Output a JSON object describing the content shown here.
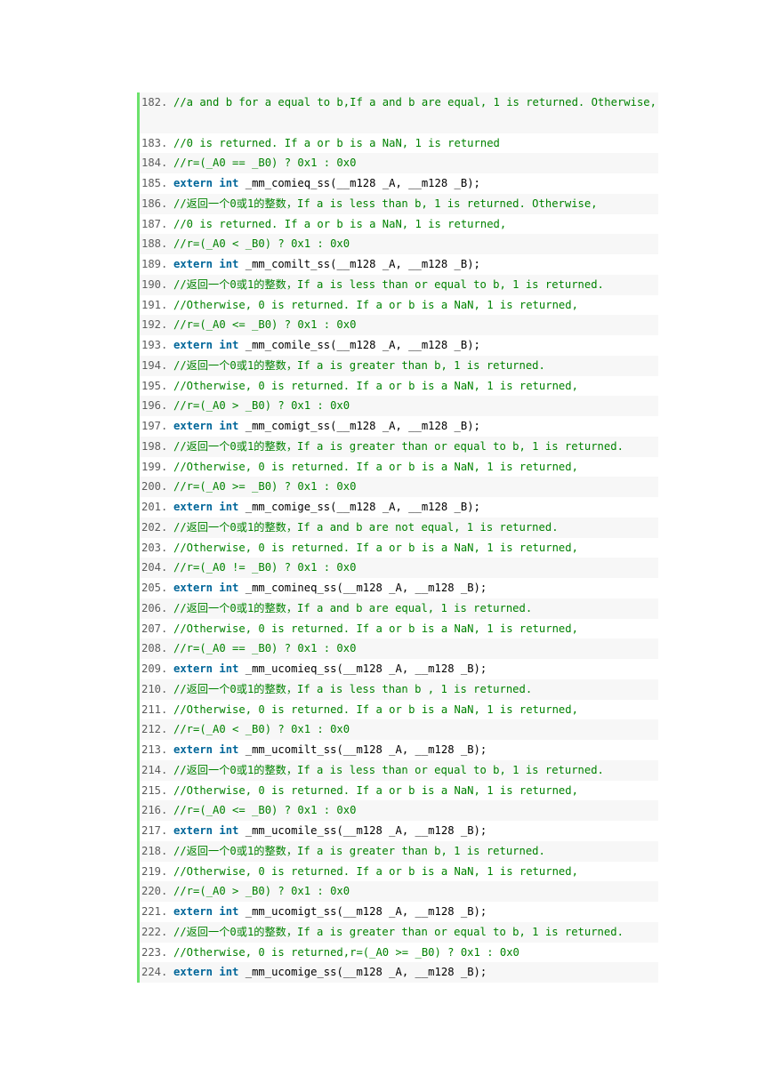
{
  "lines": [
    {
      "n": "182.",
      "parts": [
        [
          "c",
          "//a and b for a equal to b,If a and b are equal, 1 is returned. Otherwise,"
        ]
      ],
      "tall": true
    },
    {
      "n": "183.",
      "parts": [
        [
          "c",
          "//0 is returned. If a or b is a NaN, 1 is returned"
        ]
      ]
    },
    {
      "n": "184.",
      "parts": [
        [
          "c",
          "//r=(_A0 == _B0) ? 0x1 : 0x0"
        ]
      ]
    },
    {
      "n": "185.",
      "parts": [
        [
          "k",
          "extern"
        ],
        [
          "p",
          " "
        ],
        [
          "k",
          "int"
        ],
        [
          "p",
          " _mm_comieq_ss(__m128 _A, __m128 _B);"
        ]
      ]
    },
    {
      "n": "186.",
      "parts": [
        [
          "c",
          "//返回一个0或1的整数，If a is less than b, 1 is returned. Otherwise,"
        ]
      ]
    },
    {
      "n": "187.",
      "parts": [
        [
          "c",
          "//0 is returned. If a or b is a NaN, 1 is returned,"
        ]
      ]
    },
    {
      "n": "188.",
      "parts": [
        [
          "c",
          "//r=(_A0 < _B0) ? 0x1 : 0x0"
        ]
      ]
    },
    {
      "n": "189.",
      "parts": [
        [
          "k",
          "extern"
        ],
        [
          "p",
          " "
        ],
        [
          "k",
          "int"
        ],
        [
          "p",
          " _mm_comilt_ss(__m128 _A, __m128 _B);"
        ]
      ]
    },
    {
      "n": "190.",
      "parts": [
        [
          "c",
          "//返回一个0或1的整数，If a is less than or equal to b, 1 is returned."
        ]
      ]
    },
    {
      "n": "191.",
      "parts": [
        [
          "c",
          "//Otherwise, 0 is returned. If a or b is a NaN, 1 is returned,"
        ]
      ]
    },
    {
      "n": "192.",
      "parts": [
        [
          "c",
          "//r=(_A0 <= _B0) ? 0x1 : 0x0"
        ]
      ]
    },
    {
      "n": "193.",
      "parts": [
        [
          "k",
          "extern"
        ],
        [
          "p",
          " "
        ],
        [
          "k",
          "int"
        ],
        [
          "p",
          " _mm_comile_ss(__m128 _A, __m128 _B);"
        ]
      ]
    },
    {
      "n": "194.",
      "parts": [
        [
          "c",
          "//返回一个0或1的整数，If a is greater than b, 1 is returned."
        ]
      ]
    },
    {
      "n": "195.",
      "parts": [
        [
          "c",
          "//Otherwise, 0 is returned. If a or b is a NaN, 1 is returned,"
        ]
      ]
    },
    {
      "n": "196.",
      "parts": [
        [
          "c",
          "//r=(_A0 > _B0) ? 0x1 : 0x0"
        ]
      ]
    },
    {
      "n": "197.",
      "parts": [
        [
          "k",
          "extern"
        ],
        [
          "p",
          " "
        ],
        [
          "k",
          "int"
        ],
        [
          "p",
          " _mm_comigt_ss(__m128 _A, __m128 _B);"
        ]
      ]
    },
    {
      "n": "198.",
      "parts": [
        [
          "c",
          "//返回一个0或1的整数，If a is greater than or equal to b, 1 is returned."
        ]
      ]
    },
    {
      "n": "199.",
      "parts": [
        [
          "c",
          "//Otherwise, 0 is returned. If a or b is a NaN, 1 is returned,"
        ]
      ]
    },
    {
      "n": "200.",
      "parts": [
        [
          "c",
          "//r=(_A0 >= _B0) ? 0x1 : 0x0"
        ]
      ]
    },
    {
      "n": "201.",
      "parts": [
        [
          "k",
          "extern"
        ],
        [
          "p",
          " "
        ],
        [
          "k",
          "int"
        ],
        [
          "p",
          " _mm_comige_ss(__m128 _A, __m128 _B);"
        ]
      ]
    },
    {
      "n": "202.",
      "parts": [
        [
          "c",
          "//返回一个0或1的整数，If a and b are not equal, 1 is returned."
        ]
      ]
    },
    {
      "n": "203.",
      "parts": [
        [
          "c",
          "//Otherwise, 0 is returned. If a or b is a NaN, 1 is returned,"
        ]
      ]
    },
    {
      "n": "204.",
      "parts": [
        [
          "c",
          "//r=(_A0 != _B0) ? 0x1 : 0x0"
        ]
      ]
    },
    {
      "n": "205.",
      "parts": [
        [
          "k",
          "extern"
        ],
        [
          "p",
          " "
        ],
        [
          "k",
          "int"
        ],
        [
          "p",
          " _mm_comineq_ss(__m128 _A, __m128 _B);"
        ]
      ]
    },
    {
      "n": "206.",
      "parts": [
        [
          "c",
          "//返回一个0或1的整数，If a and b are equal, 1 is returned."
        ]
      ]
    },
    {
      "n": "207.",
      "parts": [
        [
          "c",
          "//Otherwise, 0 is returned. If a or b is a NaN, 1 is returned,"
        ]
      ]
    },
    {
      "n": "208.",
      "parts": [
        [
          "c",
          "//r=(_A0 == _B0) ? 0x1 : 0x0"
        ]
      ]
    },
    {
      "n": "209.",
      "parts": [
        [
          "k",
          "extern"
        ],
        [
          "p",
          " "
        ],
        [
          "k",
          "int"
        ],
        [
          "p",
          " _mm_ucomieq_ss(__m128 _A, __m128 _B);"
        ]
      ]
    },
    {
      "n": "210.",
      "parts": [
        [
          "c",
          "//返回一个0或1的整数，If a is less than b , 1 is returned."
        ]
      ]
    },
    {
      "n": "211.",
      "parts": [
        [
          "c",
          "//Otherwise, 0 is returned. If a or b is a NaN, 1 is returned,"
        ]
      ]
    },
    {
      "n": "212.",
      "parts": [
        [
          "c",
          "//r=(_A0 < _B0) ? 0x1 : 0x0"
        ]
      ]
    },
    {
      "n": "213.",
      "parts": [
        [
          "k",
          "extern"
        ],
        [
          "p",
          " "
        ],
        [
          "k",
          "int"
        ],
        [
          "p",
          " _mm_ucomilt_ss(__m128 _A, __m128 _B);"
        ]
      ]
    },
    {
      "n": "214.",
      "parts": [
        [
          "c",
          "//返回一个0或1的整数，If a is less than or equal to b, 1 is returned."
        ]
      ]
    },
    {
      "n": "215.",
      "parts": [
        [
          "c",
          "//Otherwise, 0 is returned. If a or b is a NaN, 1 is returned,"
        ]
      ]
    },
    {
      "n": "216.",
      "parts": [
        [
          "c",
          "//r=(_A0 <= _B0) ? 0x1 : 0x0"
        ]
      ]
    },
    {
      "n": "217.",
      "parts": [
        [
          "k",
          "extern"
        ],
        [
          "p",
          " "
        ],
        [
          "k",
          "int"
        ],
        [
          "p",
          " _mm_ucomile_ss(__m128 _A, __m128 _B);"
        ]
      ]
    },
    {
      "n": "218.",
      "parts": [
        [
          "c",
          "//返回一个0或1的整数，If a is greater than b, 1 is returned."
        ]
      ]
    },
    {
      "n": "219.",
      "parts": [
        [
          "c",
          "//Otherwise, 0 is returned. If a or b is a NaN, 1 is returned,"
        ]
      ]
    },
    {
      "n": "220.",
      "parts": [
        [
          "c",
          "//r=(_A0 > _B0) ? 0x1 : 0x0"
        ]
      ]
    },
    {
      "n": "221.",
      "parts": [
        [
          "k",
          "extern"
        ],
        [
          "p",
          " "
        ],
        [
          "k",
          "int"
        ],
        [
          "p",
          " _mm_ucomigt_ss(__m128 _A, __m128 _B);"
        ]
      ]
    },
    {
      "n": "222.",
      "parts": [
        [
          "c",
          "//返回一个0或1的整数，If a is greater than or equal to b, 1 is returned."
        ]
      ]
    },
    {
      "n": "223.",
      "parts": [
        [
          "c",
          "//Otherwise, 0 is returned,r=(_A0 >= _B0) ? 0x1 : 0x0"
        ]
      ]
    },
    {
      "n": "224.",
      "parts": [
        [
          "k",
          "extern"
        ],
        [
          "p",
          " "
        ],
        [
          "k",
          "int"
        ],
        [
          "p",
          " _mm_ucomige_ss(__m128 _A, __m128 _B);"
        ]
      ]
    }
  ],
  "colors": {
    "comment": "#008200",
    "keyword": "#006699",
    "line_number": "#5c5c5c",
    "gutter_bar": "#6ce26c",
    "stripe": "#f7f7f7"
  }
}
